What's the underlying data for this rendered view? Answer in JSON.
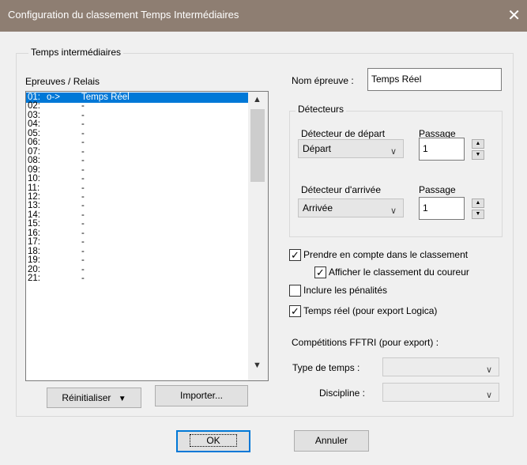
{
  "window": {
    "title": "Configuration du classement Temps Intermédiaires",
    "close_glyph": "✕"
  },
  "group_main": {
    "label": "Temps intermédiaires"
  },
  "list": {
    "label": "Epreuves / Relais",
    "rows": [
      {
        "num": "01:",
        "arrow": "o->",
        "name": "Temps Réel"
      },
      {
        "num": "02:",
        "name": "-"
      },
      {
        "num": "03:",
        "name": "-"
      },
      {
        "num": "04:",
        "name": "-"
      },
      {
        "num": "05:",
        "name": "-"
      },
      {
        "num": "06:",
        "name": "-"
      },
      {
        "num": "07:",
        "name": "-"
      },
      {
        "num": "08:",
        "name": "-"
      },
      {
        "num": "09:",
        "name": "-"
      },
      {
        "num": "10:",
        "name": "-"
      },
      {
        "num": "11:",
        "name": "-"
      },
      {
        "num": "12:",
        "name": "-"
      },
      {
        "num": "13:",
        "name": "-"
      },
      {
        "num": "14:",
        "name": "-"
      },
      {
        "num": "15:",
        "name": "-"
      },
      {
        "num": "16:",
        "name": "-"
      },
      {
        "num": "17:",
        "name": "-"
      },
      {
        "num": "18:",
        "name": "-"
      },
      {
        "num": "19:",
        "name": "-"
      },
      {
        "num": "20:",
        "name": "-"
      },
      {
        "num": "21:",
        "name": "-"
      }
    ]
  },
  "buttons": {
    "reset": "Réinitialiser",
    "import": "Importer...",
    "ok": "OK",
    "cancel": "Annuler"
  },
  "event_name": {
    "label": "Nom épreuve :",
    "value": "Temps Réel"
  },
  "detectors": {
    "label": "Détecteurs",
    "start": {
      "label": "Détecteur de départ",
      "value": "Départ",
      "passage_label": "Passage",
      "passage_value": "1"
    },
    "finish": {
      "label": "Détecteur d'arrivée",
      "value": "Arrivée",
      "passage_label": "Passage",
      "passage_value": "1"
    }
  },
  "options": {
    "include_ranking": {
      "label": "Prendre en compte dans le classement",
      "checked": true
    },
    "show_runner": {
      "label": "Afficher le classement du coureur",
      "checked": true
    },
    "penalties": {
      "label": "Inclure les pénalités",
      "checked": false
    },
    "realtime": {
      "label": "Temps réel (pour export Logica)",
      "checked": true
    }
  },
  "fftri": {
    "label": "Compétitions FFTRI (pour export) :",
    "time_type_label": "Type de temps :",
    "time_type_value": "",
    "discipline_label": "Discipline :",
    "discipline_value": ""
  }
}
